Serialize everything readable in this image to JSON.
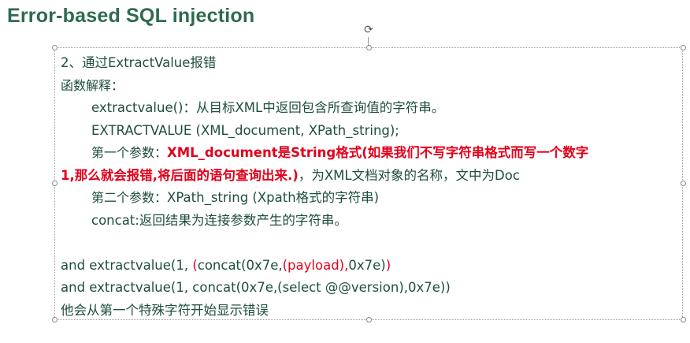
{
  "slide": {
    "title": "Error-based SQL injection"
  },
  "frame": {
    "rotate_glyph": "⟳"
  },
  "textbox": {
    "heading": "2、通过ExtractValue报错",
    "func_label": "函数解释：",
    "line_desc": "extractvalue()：从目标XML中返回包含所查询值的字符串。",
    "line_syntax": "EXTRACTVALUE (XML_document, XPath_string);",
    "param1_label": "第一个参数：",
    "param1_red_a": "XML_document是String格式(如果我们不写字符串格式而写一个数字",
    "param1_red_b": "1,那么就会报错,将后面的语句查询出来.)",
    "param1_rest": "，为XML文档对象的名称，文中为Doc",
    "param2_label": "第二个参数：",
    "param2_text": "XPath_string (Xpath格式的字符串)",
    "concat_line": "concat:返回结果为连接参数产生的字符串。",
    "example1_a": "and extractvalue(1, ",
    "example1_b": "(",
    "example1_c": "concat(0x7e,",
    "example1_d": "(payload),",
    "example1_e": "0x7e)",
    "example1_f": ")",
    "example2": "and extractvalue(1, concat(0x7e,(select @@version),0x7e))",
    "note": "他会从第一个特殊字符开始显示错误"
  },
  "colors": {
    "title": "#2e6b4f",
    "body_text": "#1f4e3d",
    "highlight": "#e3001b",
    "frame_border": "#9a9a9a"
  }
}
